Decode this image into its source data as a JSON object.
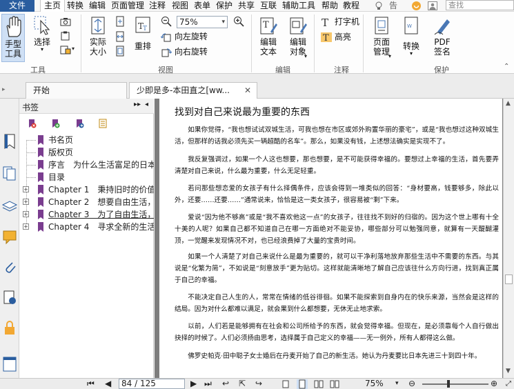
{
  "menu": {
    "file": "文件",
    "items": [
      "主页",
      "转换",
      "编辑",
      "页面管理",
      "注释",
      "视图",
      "表单",
      "保护",
      "共享",
      "互联",
      "辅助工具",
      "帮助",
      "教程"
    ],
    "tell_me": "告诉",
    "search_placeholder": "查找"
  },
  "ribbon": {
    "hand_tool": "手型\n工具",
    "select": "选择",
    "actual_size": "实际\n大小",
    "reflow": "重排",
    "zoom_value": "75%",
    "rotate_left": "向左旋转",
    "rotate_right": "向右旋转",
    "edit_text": "编辑\n文本",
    "edit_object": "编辑\n对象",
    "typewriter": "打字机",
    "highlight": "高亮",
    "page_manage": "页面\n管理",
    "convert": "转换",
    "pdf_sign": "PDF\n签名",
    "groups": {
      "tools": "工具",
      "view": "视图",
      "edit": "编辑",
      "comment": "注释",
      "protect": "保护"
    }
  },
  "tabs": [
    {
      "label": "开始"
    },
    {
      "label": "少即是多-本田直之[ww..."
    }
  ],
  "bookmarks": {
    "title": "书签",
    "items": [
      {
        "label": "书名页",
        "expandable": false
      },
      {
        "label": "版权页",
        "expandable": false
      },
      {
        "label": "序言　为什么生活富足的日本",
        "expandable": false
      },
      {
        "label": "目录",
        "expandable": false
      },
      {
        "label": "Chapter 1　秉持旧时的价值",
        "expandable": true
      },
      {
        "label": "Chapter 2　想要自由生活，",
        "expandable": true
      },
      {
        "label": "Chapter 3　为了自由生活，",
        "expandable": true
      },
      {
        "label": "Chapter 4　寻求全新的生活",
        "expandable": true
      }
    ]
  },
  "document": {
    "title": "找到对自己来说最为重要的东西",
    "paragraphs": [
      "如果你觉得，“我也想试试双城生活，可我也想在市区或郊外购置华丽的豪宅”，或是“我也想过这种双城生活，但那样的话我必须先买一辆超酷的名车”。那么，如果没有钱，上述想法确实是实现不了。",
      "我反复强调过，如果一个人这也想要，那也想要，是不可能获得幸福的。要想过上幸福的生活，首先要弄清楚对自己来说，什么最为重要，什么无足轻重。",
      "若问那些想恋爱的女孩子有什么择偶条件，应该会得到一堆类似的回答：“身材要高，钱要够多，除此以外，还要……还要……”通常说来，恰恰是这一类女孩子，很容易被“剩”下来。",
      "爱说“因为他不够高”或是“我不喜欢他这一点”的女孩子，往往找不到好的归宿的。因为这个世上哪有十全十美的人呢？如果自己都不知道自己在哪一方面绝对不能妥协，哪些部分可以勉强同意，就算有一天醍醐灌顶，一觉醒来发现情况不对，也已经浪费掉了大量的宝贵时间。",
      "如果一个人清楚了对自己来说什么是最为重要的，就可以干净利落地放弃那些生活中不需要的东西。与其说是“化繁为简”，不如说是“刻意放手”更为贴切。这样就能清晰地了解自己应该往什么方向行进，找到真正属于自己的幸福。",
      "不能决定自己人生的人，常常在情绪的低谷徘徊。如果不能探索到自身内在的快乐来源，当然会是这样的结局。因为对什么都难以满足，就会果到什么都想要，无休无止地求索。",
      "以前，人们若是能够拥有在社会和公司所给予的东西，就会觉得幸福。但现在，是必须靠每个人自行做出抉择的时候了。人们必须扬由思考，选择属于自己定义的幸福——无一例外，所有人都得这么做。",
      "佛罗史帕克·田中聪子女士婚后在丹麦开始了自己的新生活。她认为丹麦要比日本先进三十到四十年。"
    ]
  },
  "status": {
    "page": "84 / 125",
    "zoom": "75%"
  },
  "colors": {
    "accent": "#2a5d9f",
    "bookmark_flag": "#7a3d8f"
  }
}
